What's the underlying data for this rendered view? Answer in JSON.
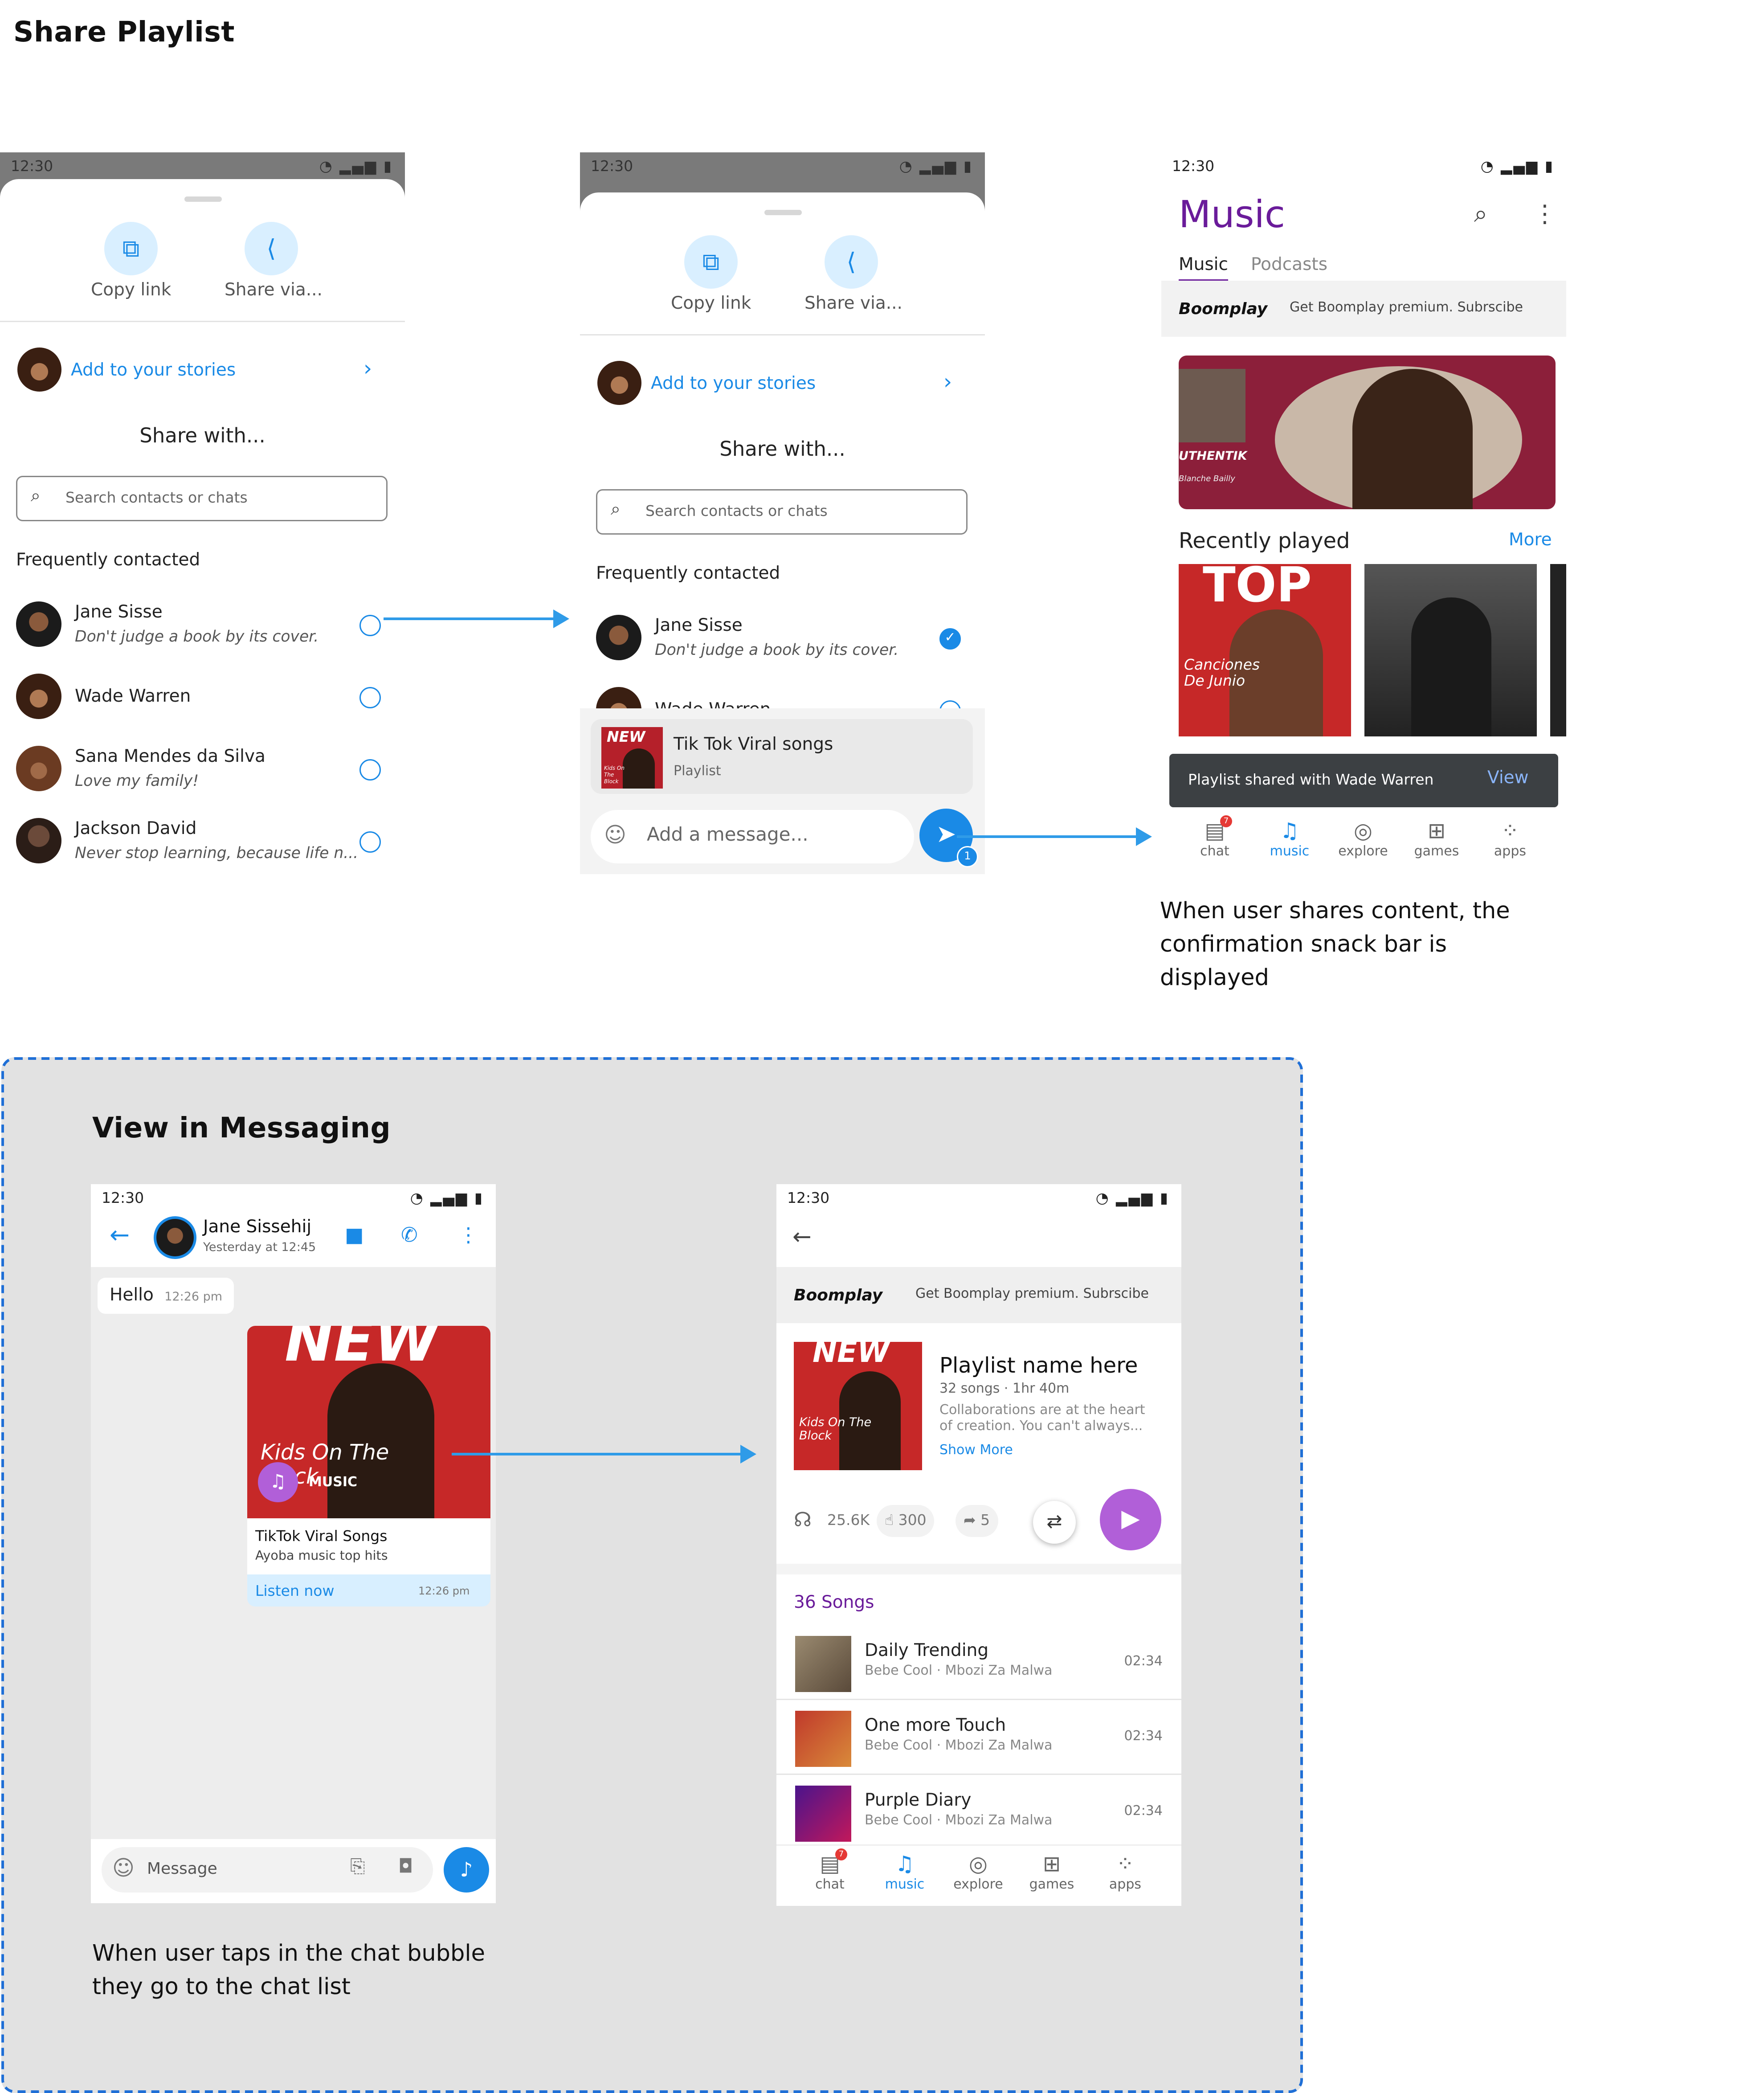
{
  "page": {
    "title": "Share Playlist"
  },
  "status": {
    "time": "12:30",
    "icons": "wifi-icon signal-icon battery-icon"
  },
  "share_sheet": {
    "copy_link": "Copy link",
    "share_via": "Share via...",
    "add_story": "Add to your stories",
    "share_with": "Share with...",
    "search_placeholder": "Search contacts or chats",
    "frequent": "Frequently contacted",
    "contacts": [
      {
        "name": "Jane Sisse",
        "sub": "Don't judge a book by its cover."
      },
      {
        "name": "Wade Warren",
        "sub": ""
      },
      {
        "name": "Sana Mendes da Silva",
        "sub": "Love my family!"
      },
      {
        "name": "Jackson David",
        "sub": "Never stop learning, because life n..."
      }
    ],
    "partial_contact": "Wade Warren",
    "share_item_title": "Tik Tok Viral songs",
    "share_item_type": "Playlist",
    "message_placeholder": "Add a message...",
    "send_count": "1",
    "art_new": "NEW",
    "art_kids": "Kids On The Block"
  },
  "music_screen": {
    "title": "Music",
    "tabs": [
      "Music",
      "Podcasts"
    ],
    "boomplay": "Boomplay",
    "promo": "Get Boomplay premium. Subrscibe",
    "banner_text": "UTHENTIK",
    "banner_sub": "Blanche Bailly",
    "recent_title": "Recently played",
    "more": "More",
    "card1_top": "TOP",
    "card1_caption": "Canciones De Junio",
    "snackbar": "Playlist shared with Wade Warren",
    "snackbar_action": "View"
  },
  "nav": [
    "chat",
    "music",
    "explore",
    "games",
    "apps"
  ],
  "nav_badge": "7",
  "caption1": "When user shares content, the confirmation snack bar is displayed",
  "messaging": {
    "title": "View in Messaging",
    "contact_name": "Jane Sissehij",
    "last_seen": "Yesterday at 12:45",
    "bubble_text": "Hello",
    "bubble_time": "12:26 pm",
    "card_new": "NEW",
    "card_kids": "Kids On The Block",
    "card_music": "MUSIC",
    "card_title": "TikTok Viral Songs",
    "card_sub": "Ayoba music top hits",
    "card_action": "Listen now",
    "card_time": "12:26 pm",
    "input_placeholder": "Message",
    "caption": "When user taps in the chat bubble they go to the chat list"
  },
  "playlist": {
    "boomplay": "Boomplay",
    "promo": "Get Boomplay premium. Subrscibe",
    "art_new": "NEW",
    "art_kids": "Kids On The Block",
    "name": "Playlist name here",
    "meta": "32 songs · 1hr 40m",
    "desc": "Collaborations are at the heart of creation. You can't always...",
    "show_more": "Show More",
    "listens": "25.6K",
    "likes": "300",
    "shares": "5",
    "songs_count": "36 Songs",
    "songs": [
      {
        "title": "Daily Trending",
        "artist": "Bebe Cool · Mbozi Za Malwa",
        "time": "02:34"
      },
      {
        "title": "One more Touch",
        "artist": "Bebe Cool · Mbozi Za Malwa",
        "time": "02:34"
      },
      {
        "title": "Purple Diary",
        "artist": "Bebe Cool · Mbozi Za Malwa",
        "time": "02:34"
      }
    ]
  },
  "colors": {
    "accent_blue": "#1a8ae6",
    "music_purple": "#6a1b9a",
    "play_purple": "#b15fd8",
    "dash_blue": "#1f6fd6"
  }
}
